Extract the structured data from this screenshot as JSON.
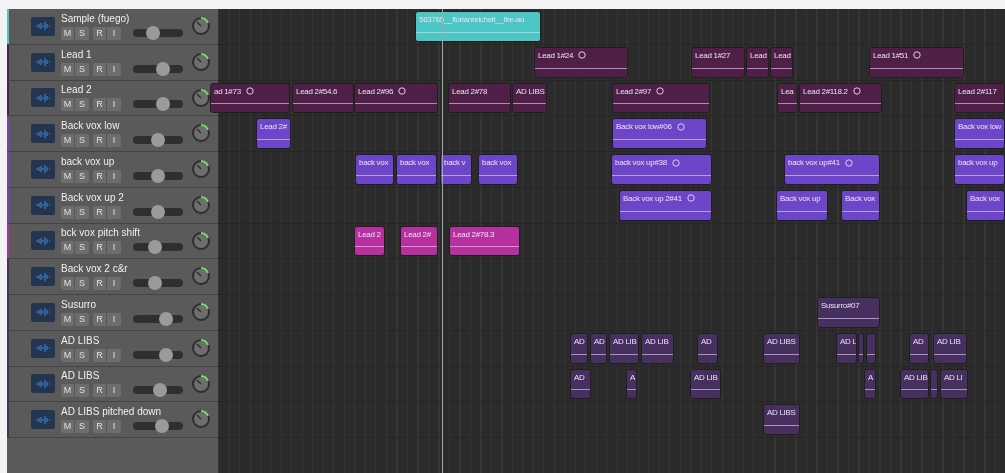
{
  "tracks": [
    {
      "name": "Sample (fuego)",
      "color": "#4cc7c6",
      "level": 0.35,
      "buttons": [
        "M",
        "S",
        "R",
        "I"
      ],
      "regions": [
        {
          "name": "563765__florianreichelt__fire-au",
          "looped": false
        }
      ]
    },
    {
      "name": "Lead 1",
      "color": "#4f1f47",
      "level": 0.65,
      "buttons": [
        "M",
        "S",
        "R",
        "I"
      ],
      "regions": [
        {
          "name": "Lead 1#24",
          "looped": true
        },
        {
          "name": "Lead 1#27",
          "looped": false
        },
        {
          "name": "Lead",
          "looped": false
        },
        {
          "name": "Lead",
          "looped": false
        },
        {
          "name": "Lead 1#51",
          "looped": true
        }
      ]
    },
    {
      "name": "Lead 2",
      "color": "#4f1f47",
      "level": 0.65,
      "buttons": [
        "M",
        "S",
        "R",
        "I"
      ],
      "regions": [
        {
          "name": "ad 1#73",
          "looped": true
        },
        {
          "name": "Lead 2#54.6",
          "looped": false
        },
        {
          "name": "Lead 2#96",
          "looped": true
        },
        {
          "name": "Lead 2#78",
          "looped": false
        },
        {
          "name": "AD LIBS",
          "looped": false
        },
        {
          "name": "Lead 2#97",
          "looped": true
        },
        {
          "name": "Lea",
          "looped": false
        },
        {
          "name": "Lead 2#118.2",
          "looped": true
        },
        {
          "name": "Lead 2#117",
          "looped": false
        }
      ]
    },
    {
      "name": "Back vox low",
      "color": "#6d45c8",
      "level": 0.5,
      "buttons": [
        "M",
        "S",
        "R",
        "I"
      ],
      "regions": [
        {
          "name": "Lead 2#",
          "looped": false
        },
        {
          "name": "Back vox low#06",
          "looped": true
        },
        {
          "name": "Back vox low",
          "looped": false
        }
      ]
    },
    {
      "name": "back vox up",
      "color": "#6d45c8",
      "level": 0.5,
      "buttons": [
        "M",
        "S",
        "R",
        "I"
      ],
      "regions": [
        {
          "name": "back vox",
          "looped": false
        },
        {
          "name": "back vox",
          "looped": false
        },
        {
          "name": "back v",
          "looped": false
        },
        {
          "name": "back vox",
          "looped": false
        },
        {
          "name": "back vox up#38",
          "looped": true
        },
        {
          "name": "back vox up#41",
          "looped": true
        },
        {
          "name": "back vox up",
          "looped": false
        }
      ]
    },
    {
      "name": "Back vox up 2",
      "color": "#6d45c8",
      "level": 0.5,
      "buttons": [
        "M",
        "S",
        "R",
        "I"
      ],
      "regions": [
        {
          "name": "Back vox up 2#41",
          "looped": true
        },
        {
          "name": "Back vox up",
          "looped": false
        },
        {
          "name": "Back vox",
          "looped": false
        },
        {
          "name": "Back vox",
          "looped": false
        }
      ]
    },
    {
      "name": "bck vox pitch shift",
      "color": "#b6319f",
      "level": 0.42,
      "buttons": [
        "M",
        "S",
        "R",
        "I"
      ],
      "regions": [
        {
          "name": "Lead 2",
          "looped": false
        },
        {
          "name": "Lead 2#",
          "looped": false
        },
        {
          "name": "Lead 2#78.3",
          "looped": false
        }
      ]
    },
    {
      "name": "Back vox 2 c&r",
      "color": "#47305f",
      "level": 0.42,
      "buttons": [
        "M",
        "S",
        "R",
        "I"
      ]
    },
    {
      "name": "Susurro",
      "color": "#47305f",
      "level": 0.72,
      "buttons": [
        "M",
        "S",
        "R",
        "I"
      ],
      "regions": [
        {
          "name": "Susurro#07",
          "looped": false
        }
      ]
    },
    {
      "name": "AD LIBS",
      "color": "#47305f",
      "level": 0.72,
      "buttons": [
        "M",
        "S",
        "R",
        "I"
      ],
      "regions": [
        {
          "name": "AD",
          "looped": false
        },
        {
          "name": "AD",
          "looped": false
        },
        {
          "name": "AD LIB",
          "looped": false
        },
        {
          "name": "AD LIB",
          "looped": false
        },
        {
          "name": "AD",
          "looped": false
        },
        {
          "name": "AD LIBS",
          "looped": false
        },
        {
          "name": "AD L",
          "looped": false
        },
        {
          "looped": false
        },
        {
          "looped": false
        },
        {
          "name": "AD",
          "looped": false
        },
        {
          "name": "AD LIB",
          "looped": false
        }
      ]
    },
    {
      "name": "AD LIBS",
      "color": "#47305f",
      "level": 0.55,
      "buttons": [
        "M",
        "S",
        "R",
        "I"
      ],
      "regions": [
        {
          "name": "AD",
          "looped": false
        },
        {
          "name": "A",
          "looped": false
        },
        {
          "name": "AD LIB",
          "looped": false
        },
        {
          "name": "A",
          "looped": false
        },
        {
          "name": "AD LIB",
          "looped": false
        },
        {
          "looped": false
        },
        {
          "name": "AD LI",
          "looped": false
        }
      ]
    },
    {
      "name": "AD LIBS pitched down",
      "color": "#47305f",
      "level": 0.62,
      "buttons": [
        "M",
        "S",
        "R",
        "I"
      ],
      "regions": [
        {
          "name": "AD LIBS",
          "looped": false
        }
      ]
    }
  ]
}
